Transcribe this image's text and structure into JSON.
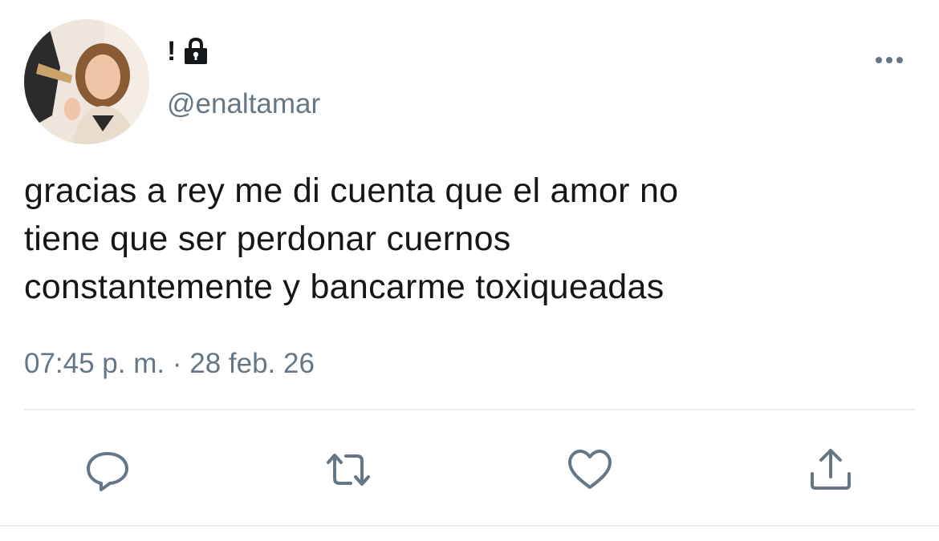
{
  "user": {
    "display_name": "!",
    "handle": "@enaltamar",
    "protected": true
  },
  "tweet": {
    "text_lines": [
      "gracias a rey me di cuenta que el amor no",
      "tiene que ser perdonar cuernos",
      "constantemente y bancarme toxiqueadas"
    ],
    "time": "07:45 p. m.",
    "separator": "·",
    "date": "28 feb. 26"
  },
  "actions": {
    "icons": [
      "reply-icon",
      "retweet-icon",
      "like-icon",
      "share-icon"
    ]
  },
  "colors": {
    "text": "#14171a",
    "secondary": "#657786",
    "divider": "#e6ecf0"
  }
}
